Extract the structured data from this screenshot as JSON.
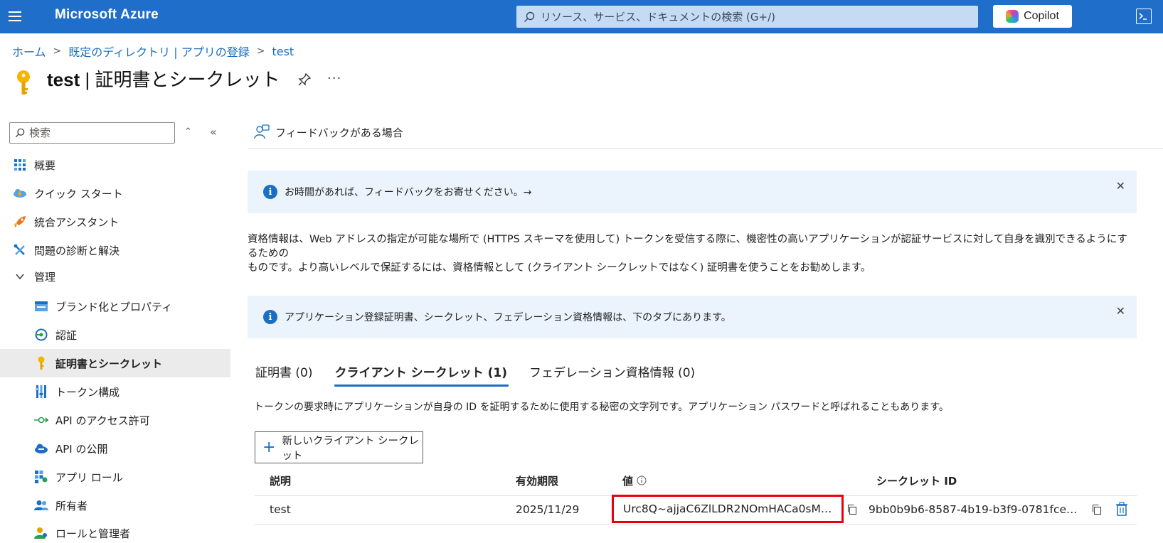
{
  "topbar": {
    "brand": "Microsoft Azure",
    "search_placeholder": "リソース、サービス、ドキュメントの検索 (G+/)",
    "copilot_label": "Copilot"
  },
  "breadcrumb": [
    "ホーム",
    "既定のディレクトリ | アプリの登録",
    "test"
  ],
  "page": {
    "title_app": "test",
    "title_sep": " | ",
    "title_section": "証明書とシークレット",
    "more": "···"
  },
  "sidebar": {
    "search_placeholder": "検索",
    "items": [
      {
        "label": "概要",
        "icon": "grid-icon"
      },
      {
        "label": "クイック スタート",
        "icon": "cloud-lightning-icon"
      },
      {
        "label": "統合アシスタント",
        "icon": "rocket-icon"
      },
      {
        "label": "問題の診断と解決",
        "icon": "tools-icon"
      },
      {
        "label": "管理",
        "icon": "chevron-down-icon"
      },
      {
        "label": "ブランド化とプロパティ",
        "icon": "branding-icon"
      },
      {
        "label": "認証",
        "icon": "auth-icon"
      },
      {
        "label": "証明書とシークレット",
        "icon": "key-icon"
      },
      {
        "label": "トークン構成",
        "icon": "token-icon"
      },
      {
        "label": "API のアクセス許可",
        "icon": "api-permission-icon"
      },
      {
        "label": "API の公開",
        "icon": "cloud-api-icon"
      },
      {
        "label": "アプリ ロール",
        "icon": "app-roles-icon"
      },
      {
        "label": "所有者",
        "icon": "owners-icon"
      },
      {
        "label": "ロールと管理者",
        "icon": "roles-admins-icon"
      }
    ]
  },
  "main": {
    "feedback_link": "フィードバックがある場合",
    "banner1": "お時間があれば、フィードバックをお寄せください。→",
    "description_line1": "資格情報は、Web アドレスの指定が可能な場所で (HTTPS スキーマを使用して) トークンを受信する際に、機密性の高いアプリケーションが認証サービスに対して自身を識別できるようにするための",
    "description_line2": "ものです。より高いレベルで保証するには、資格情報として (クライアント シークレットではなく) 証明書を使うことをお勧めします。",
    "banner2": "アプリケーション登録証明書、シークレット、フェデレーション資格情報は、下のタブにあります。",
    "tabs": [
      "証明書 (0)",
      "クライアント シークレット (1)",
      "フェデレーション資格情報 (0)"
    ],
    "tab_description": "トークンの要求時にアプリケーションが自身の ID を証明するために使用する秘密の文字列です。アプリケーション パスワードと呼ばれることもあります。",
    "new_secret_label": "新しいクライアント シークレット",
    "table": {
      "headers": [
        "説明",
        "有効期限",
        "値",
        "シークレット ID"
      ],
      "rows": [
        {
          "description": "test",
          "expires": "2025/11/29",
          "value": "Urc8Q~ajjaC6ZlLDR2NOmHACa0sM…",
          "secret_id": "9bb0b9b6-8587-4b19-b3f9-0781fce…"
        }
      ]
    }
  },
  "colors": {
    "accent": "#1f6ec9",
    "highlight_border": "#e8000b",
    "banner_bg": "#ebf3fc"
  }
}
